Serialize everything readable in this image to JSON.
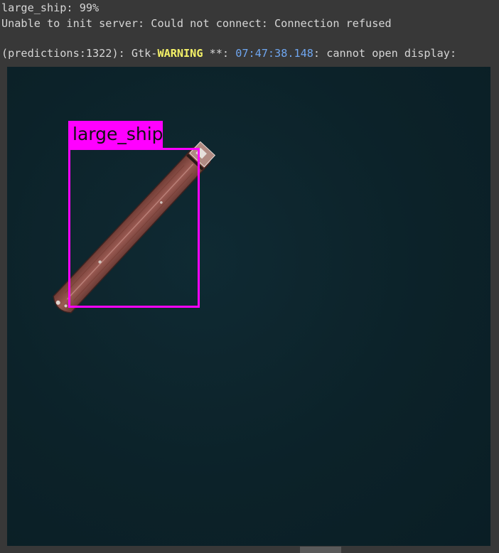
{
  "output": {
    "line1": "large_ship: 99%",
    "line2": "Unable to init server: Could not connect: Connection refused",
    "line3": {
      "prefix": "(predictions:1322): Gtk-",
      "warning": "WARNING",
      "mid": " **: ",
      "timestamp": "07:47:38.148",
      "suffix": ": cannot open display:"
    }
  },
  "detection": {
    "label": "large_ship",
    "box_color": "#ff00ff"
  },
  "colors": {
    "background": "#383838",
    "warning": "#f5f268",
    "timestamp": "#6fa6f0"
  }
}
